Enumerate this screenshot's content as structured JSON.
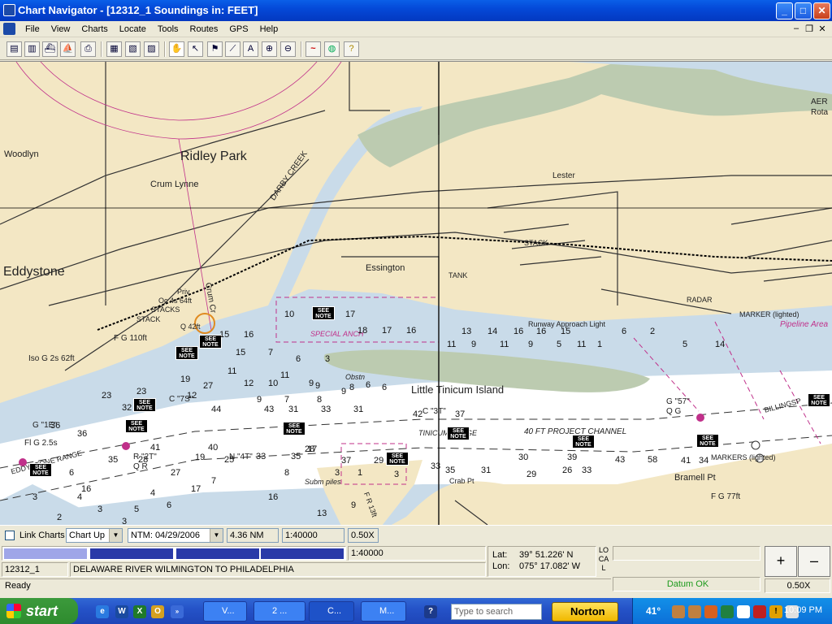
{
  "window": {
    "title": "Chart Navigator - [12312_1 Soundings in: FEET]",
    "controls": {
      "minimize": "_",
      "maximize": "□",
      "close": "✕"
    }
  },
  "menu": {
    "items": [
      "File",
      "View",
      "Charts",
      "Locate",
      "Tools",
      "Routes",
      "GPS",
      "Help"
    ],
    "mdi": {
      "minimize": "–",
      "restore": "❐",
      "close": "✕"
    }
  },
  "toolbar": {
    "icons": [
      "open-chart-icon",
      "chart-list-icon",
      "boat-icon",
      "ship-icon",
      "print-icon",
      "grid-icon",
      "layers-icon",
      "catalog-icon",
      "hand-pan-icon",
      "select-arrow-icon",
      "waypoint-flag-icon",
      "measure-line-icon",
      "text-tool-icon",
      "zoom-in-icon",
      "zoom-out-icon",
      "gps-signal-icon",
      "globe-icon",
      "help-icon"
    ],
    "glyphs": [
      "▤",
      "▥",
      "⛴",
      "⛵",
      "⎙",
      "▦",
      "▧",
      "▨",
      "✋",
      "↖",
      "⚑",
      "⟋",
      "A",
      "⊕",
      "⊖",
      "~",
      "◍",
      "?"
    ]
  },
  "chart": {
    "labels": {
      "ridley_park": "Ridley Park",
      "woodlyn": "Woodlyn",
      "crum_lynne": "Crum Lynne",
      "eddystone": "Eddystone",
      "darby_creek": "DARBY CREEK",
      "essington": "Essington",
      "lester": "Lester",
      "stack1": "STACK",
      "stack2": "STACK",
      "stacks": "STACKS",
      "tank": "TANK",
      "radar": "RADAR",
      "marker": "MARKER (lighted)",
      "little_tinicum": "Little Tinicum Island",
      "project_channel": "40 FT PROJECT CHANNEL",
      "tinicum_range": "TINICUM RANGE",
      "eddystone_range": "EDDYSTONE RANGE",
      "billingsport": "BILLINGSP",
      "bramell_pt": "Bramell Pt",
      "crab_pt": "Crab Pt",
      "markers_lighted": "MARKERS (lighted)",
      "fg77": "F G 77ft",
      "fg110": "F G 110ft",
      "iso_g": "Iso G 2s 62ft",
      "priv": "Priv",
      "oc4s": "Oc 4s 64ft",
      "q42": "Q 42ft",
      "special_anch": "SPECIAL ANCH",
      "pipeline_area": "Pipeline Area",
      "runway": "Runway Approach Light",
      "aero": "AER",
      "rota": "Rota",
      "fr13": "F R 13ft",
      "subm_piles": "Subm piles",
      "obstn": "Obstn",
      "crum_cr": "Crum Cr",
      "g1e": "G \"1E\"",
      "flg25": "Fl G 2.5s",
      "r2t": "R \"2T\"",
      "qr": "Q R",
      "n4t": "N \"4T\"",
      "c3t": "C \"3T\"",
      "c7s": "C \"7S\"",
      "g57": "G \"57\"",
      "qg": "Q G",
      "see_note": "SEE NOTE"
    },
    "soundings": [
      "10",
      "18",
      "17",
      "16",
      "17",
      "13",
      "14",
      "16",
      "16",
      "15",
      "6",
      "2",
      "15",
      "16",
      "15",
      "7",
      "6",
      "3",
      "11",
      "9",
      "9",
      "11",
      "9",
      "11",
      "9",
      "5",
      "11",
      "1",
      "5",
      "14",
      "12",
      "10",
      "9",
      "8",
      "6",
      "6",
      "11",
      "9",
      "7",
      "8",
      "23",
      "23",
      "27",
      "19",
      "36",
      "32",
      "44",
      "43",
      "31",
      "33",
      "31",
      "42",
      "37",
      "28",
      "16",
      "12",
      "36",
      "41",
      "40",
      "33",
      "35",
      "19",
      "17",
      "37",
      "29",
      "33",
      "35",
      "31",
      "29",
      "26",
      "33",
      "30",
      "39",
      "43",
      "58",
      "41",
      "34",
      "35",
      "28",
      "25",
      "27",
      "17",
      "7",
      "6",
      "3",
      "4",
      "3",
      "5",
      "2",
      "3",
      "4",
      "6",
      "3",
      "1",
      "3",
      "9",
      "8",
      "16",
      "13",
      "5",
      "15",
      "16",
      "9"
    ]
  },
  "controls": {
    "link_charts": "Link Charts",
    "chart_orientation": "Chart Up",
    "ntm": "NTM: 04/29/2006",
    "range": "4.36 NM",
    "scale": "1:40000",
    "zoom": "0.50X"
  },
  "status": {
    "scale_value": "1:40000",
    "chart_id": "12312_1",
    "chart_name": "DELAWARE RIVER WILMINGTON TO PHILADELPHIA",
    "lat_label": "Lat:",
    "lat_value": "39° 51.226' N",
    "lon_label": "Lon:",
    "lon_value": "075° 17.082' W",
    "time_mode": "LOCAL",
    "datum": "Datum OK",
    "zoom_plus": "+",
    "zoom_minus": "–",
    "zoom_value": "0.50X",
    "ready": "Ready"
  },
  "taskbar": {
    "start": "start",
    "tasks": [
      "V...",
      "2 ...",
      "C...",
      "M..."
    ],
    "search_placeholder": "Type to search",
    "norton": "Norton",
    "temperature": "41°",
    "clock": "10:09 PM"
  },
  "colors": {
    "land": "#f3e7c4",
    "water_shallow": "#c9dbe9",
    "water_deep": "#ffffff",
    "magenta": "#c0308a",
    "titlebar": "#0449D8",
    "accent_green": "#1c9a1c"
  }
}
